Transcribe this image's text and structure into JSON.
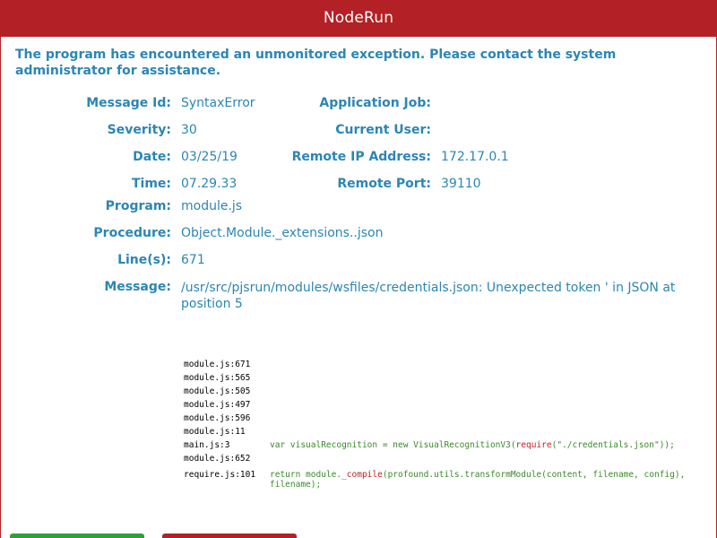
{
  "window": {
    "title": "NodeRun"
  },
  "error": {
    "heading": "The program has encountered an unmonitored exception. Please contact the system administrator for assistance."
  },
  "details": {
    "message_id_label": "Message Id:",
    "message_id": "SyntaxError",
    "severity_label": "Severity:",
    "severity": "30",
    "date_label": "Date:",
    "date": "03/25/19",
    "time_label": "Time:",
    "time": "07.29.33",
    "program_label": "Program:",
    "program": "module.js",
    "procedure_label": "Procedure:",
    "procedure": "Object.Module._extensions..json",
    "lines_label": "Line(s):",
    "lines": "671",
    "message_label": "Message:",
    "message": "/usr/src/pjsrun/modules/wsfiles/credentials.json: Unexpected token ' in JSON at position 5",
    "application_job_label": "Application Job:",
    "application_job": "",
    "current_user_label": "Current User:",
    "current_user": "",
    "remote_ip_label": "Remote IP Address:",
    "remote_ip": "172.17.0.1",
    "remote_port_label": "Remote Port:",
    "remote_port": "39110"
  },
  "stack_trace": [
    {
      "file": "module.js:671",
      "code_pre": "",
      "code_kw": "",
      "code_post": ""
    },
    {
      "file": "module.js:565",
      "code_pre": "",
      "code_kw": "",
      "code_post": ""
    },
    {
      "file": "module.js:505",
      "code_pre": "",
      "code_kw": "",
      "code_post": ""
    },
    {
      "file": "module.js:497",
      "code_pre": "",
      "code_kw": "",
      "code_post": ""
    },
    {
      "file": "module.js:596",
      "code_pre": "",
      "code_kw": "",
      "code_post": ""
    },
    {
      "file": "module.js:11",
      "code_pre": "",
      "code_kw": "",
      "code_post": ""
    },
    {
      "file": "main.js:3",
      "code_pre": "var visualRecognition = new VisualRecognitionV3(",
      "code_kw": "require",
      "code_post": "(\"./credentials.json\"));"
    },
    {
      "file": "module.js:652",
      "code_pre": "",
      "code_kw": "",
      "code_post": ""
    },
    {
      "file": "require.js:101",
      "code_pre": "return module.",
      "code_kw": "_compile",
      "code_post": "(profound.utils.transformModule(content, filename, config), filename);"
    }
  ],
  "colors": {
    "title_bar": "#b32025",
    "text_accent": "#2b86b4",
    "code_green": "#3a8a2a",
    "code_keyword": "#c0202a",
    "button_green": "#2aa334",
    "button_red": "#b32025"
  }
}
